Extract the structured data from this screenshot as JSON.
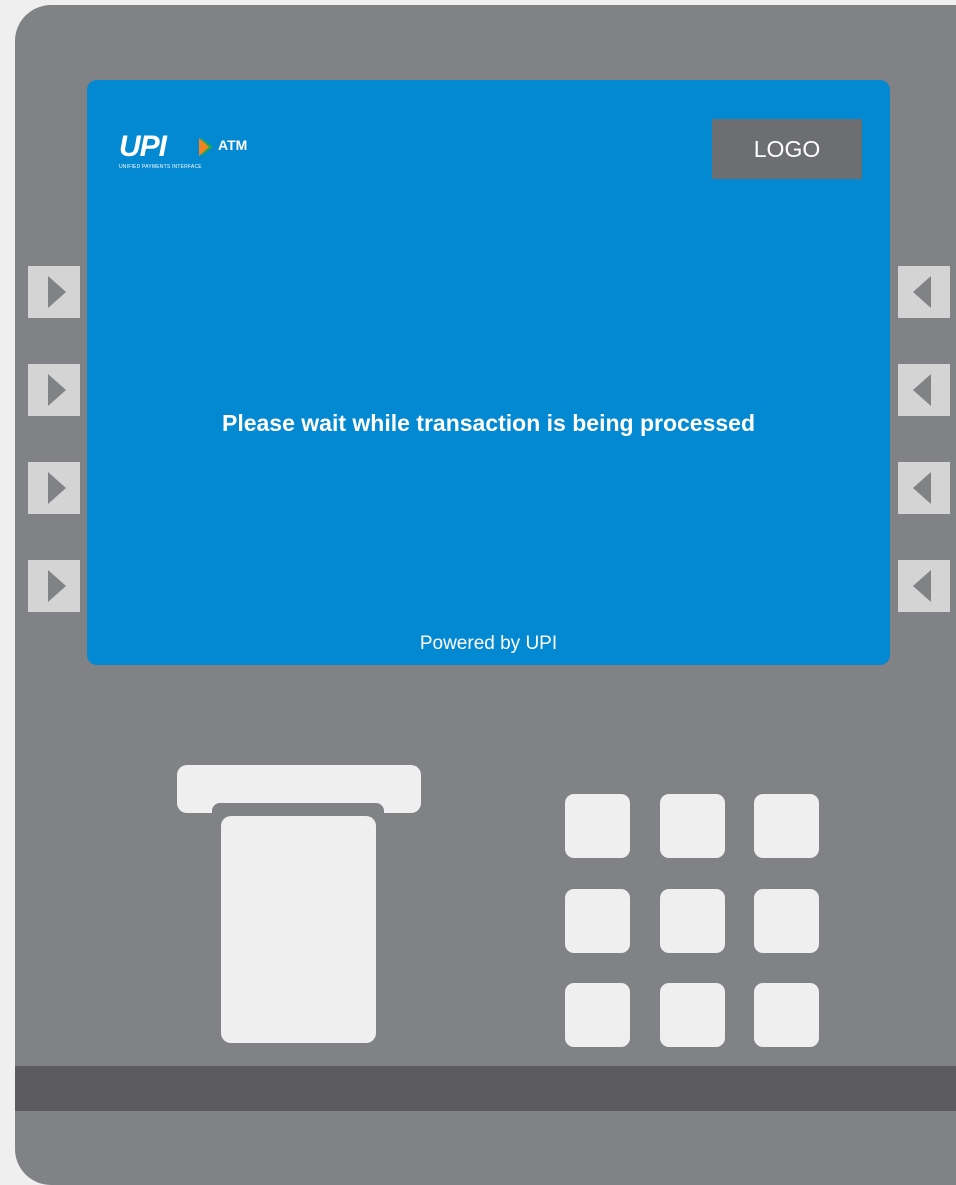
{
  "brand": {
    "mark": "UPI",
    "suffix": "ATM",
    "tagline": "UNIFIED PAYMENTS INTERFACE"
  },
  "screen": {
    "logo_placeholder": "LOGO",
    "message": "Please wait while transaction is being processed",
    "footer": "Powered by UPI"
  },
  "colors": {
    "screen_bg": "#0388d2",
    "machine_body": "#818285",
    "logo_box": "#6d6e71",
    "side_button": "#d4d4d4",
    "keypad_key": "#efefef",
    "bottom_strip": "#5c5c5e",
    "upi_orange": "#f58220",
    "upi_green": "#21a84f"
  },
  "side_buttons": {
    "left": [
      "arrow-right-icon",
      "arrow-right-icon",
      "arrow-right-icon",
      "arrow-right-icon"
    ],
    "right": [
      "arrow-left-icon",
      "arrow-left-icon",
      "arrow-left-icon",
      "arrow-left-icon"
    ]
  }
}
